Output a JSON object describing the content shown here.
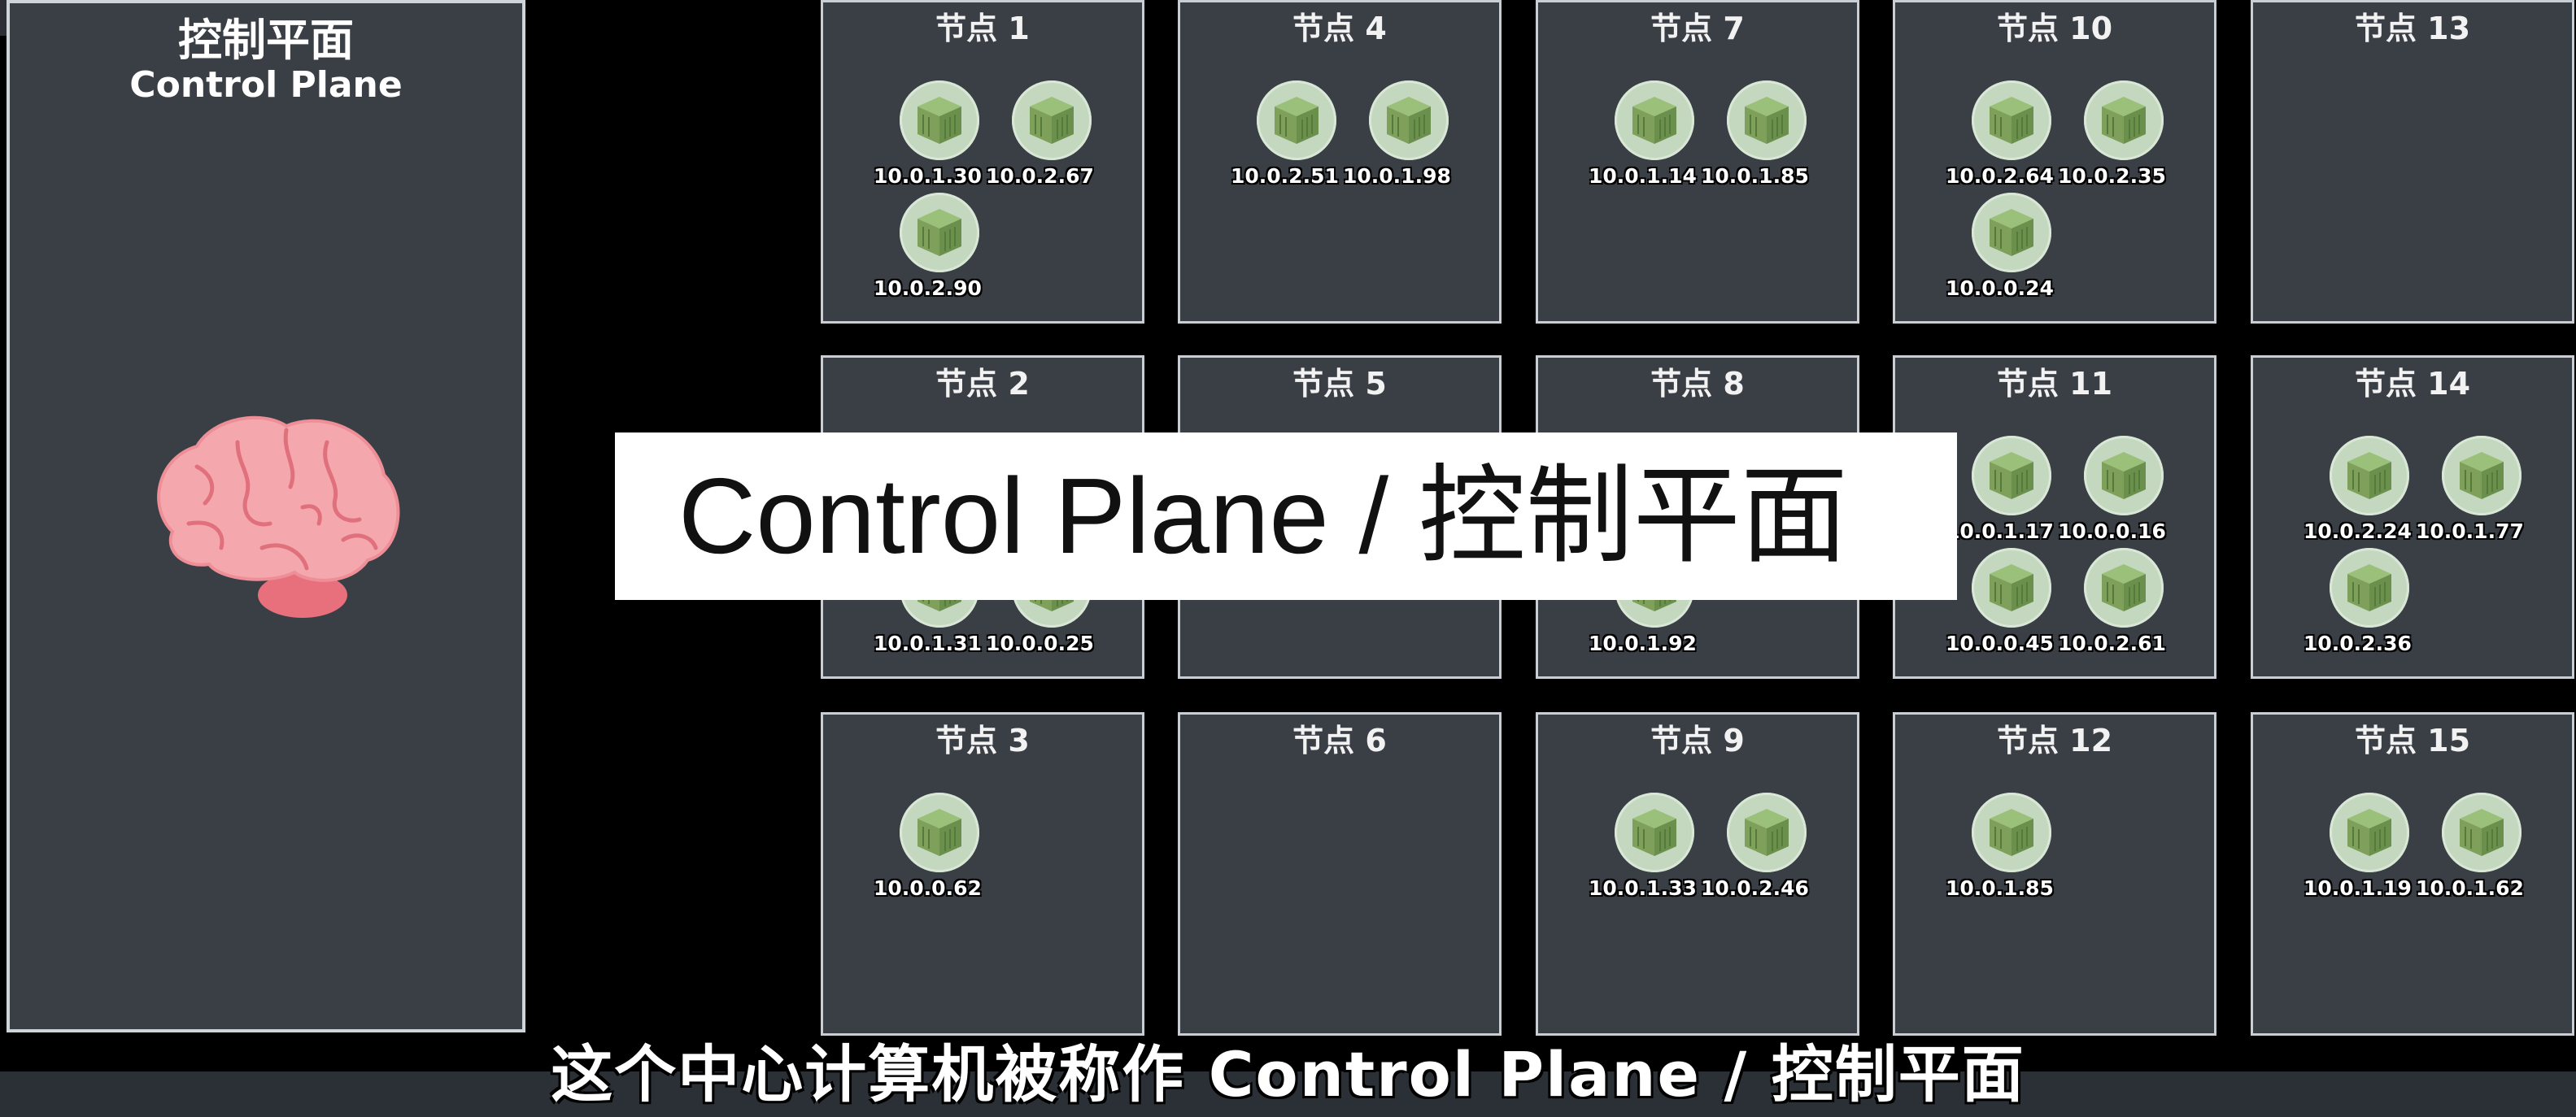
{
  "control_plane": {
    "title_cn": "控制平面",
    "title_en": "Control Plane",
    "icon": "brain-icon"
  },
  "nodes": [
    {
      "title": "节点 1",
      "pods": [
        "10.0.1.30",
        "10.0.2.67",
        "10.0.2.90"
      ]
    },
    {
      "title": "节点 2",
      "pods": [
        "",
        "",
        "10.0.1.31",
        "10.0.0.25"
      ]
    },
    {
      "title": "节点 3",
      "pods": [
        "10.0.0.62"
      ]
    },
    {
      "title": "节点 4",
      "pods": [
        "10.0.2.51",
        "10.0.1.98"
      ]
    },
    {
      "title": "节点 5",
      "pods": []
    },
    {
      "title": "节点 6",
      "pods": []
    },
    {
      "title": "节点 7",
      "pods": [
        "10.0.1.14",
        "10.0.1.85"
      ]
    },
    {
      "title": "节点 8",
      "pods": [
        "",
        "",
        "10.0.1.92"
      ]
    },
    {
      "title": "节点 9",
      "pods": [
        "10.0.1.33",
        "10.0.2.46"
      ]
    },
    {
      "title": "节点 10",
      "pods": [
        "10.0.2.64",
        "10.0.2.35",
        "10.0.0.24"
      ]
    },
    {
      "title": "节点 11",
      "pods": [
        "10.0.1.17",
        "10.0.0.16",
        "10.0.0.45",
        "10.0.2.61"
      ]
    },
    {
      "title": "节点 12",
      "pods": [
        "10.0.1.85"
      ]
    },
    {
      "title": "节点 13",
      "pods": []
    },
    {
      "title": "节点 14",
      "pods": [
        "10.0.2.24",
        "10.0.1.77",
        "10.0.2.36"
      ]
    },
    {
      "title": "节点 15",
      "pods": [
        "10.0.1.19",
        "10.0.1.62"
      ]
    }
  ],
  "overlay_title": "Control Plane / 控制平面",
  "subtitle": "这个中心计算机被称作 Control Plane / 控制平面",
  "colors": {
    "background": "#000000",
    "panel": "#3a3e45",
    "panel_border": "#cfd4d9",
    "pod_circle": "#c4d7bf",
    "pod_cube": "#7fa05a"
  }
}
